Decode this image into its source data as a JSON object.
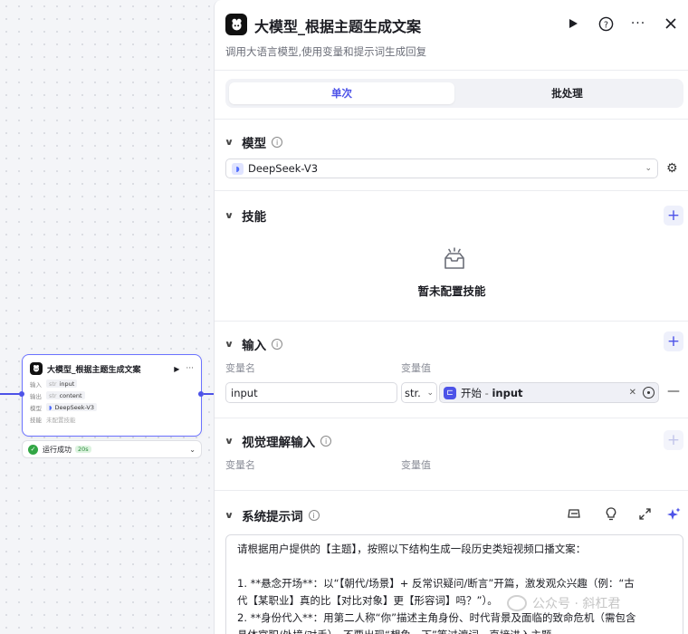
{
  "node": {
    "title": "大模型_根据主题生成文案",
    "rows": [
      {
        "label": "输入",
        "type": "str",
        "value": "input"
      },
      {
        "label": "输出",
        "type": "str",
        "value": "content"
      },
      {
        "label": "模型",
        "type": "",
        "value": "DeepSeek-V3"
      },
      {
        "label": "技能",
        "type": "",
        "value": "未配置技能"
      }
    ],
    "status": "运行成功",
    "time": "20s"
  },
  "panel": {
    "title": "大模型_根据主题生成文案",
    "description": "调用大语言模型,使用变量和提示词生成回复",
    "tabs": {
      "single": "单次",
      "batch": "批处理"
    },
    "model_section": {
      "title": "模型",
      "selected": "DeepSeek-V3"
    },
    "skills_section": {
      "title": "技能",
      "empty_text": "暂未配置技能"
    },
    "input_section": {
      "title": "输入",
      "col_name": "变量名",
      "col_value": "变量值",
      "var_name": "input",
      "var_type": "str.",
      "ref_source": "开始",
      "ref_sep": " - ",
      "ref_var": "input"
    },
    "vision_section": {
      "title": "视觉理解输入",
      "col_name": "变量名",
      "col_value": "变量值"
    },
    "prompt_section": {
      "title": "系统提示词",
      "lines": [
        "请根据用户提供的【主题】，按照以下结构生成一段历史类短视频口播文案：",
        "",
        "1. **悬念开场**：以“【朝代/场景】+ 反常识疑问/断言”开篇，激发观众兴趣（例：“古",
        "代【某职业】真的比【对比对象】更【形容词】吗？”）。",
        "2. **身份代入**：用第二人称“你”描述主角身份、时代背景及面临的致命危机（需包含",
        "具体官职/处境/对手），不要出现“想象一下”等过渡词，直接进入主题。"
      ]
    }
  },
  "watermark": "公众号 · 斜杠君",
  "colors": {
    "accent": "#4d53e8",
    "success": "#32a645"
  }
}
